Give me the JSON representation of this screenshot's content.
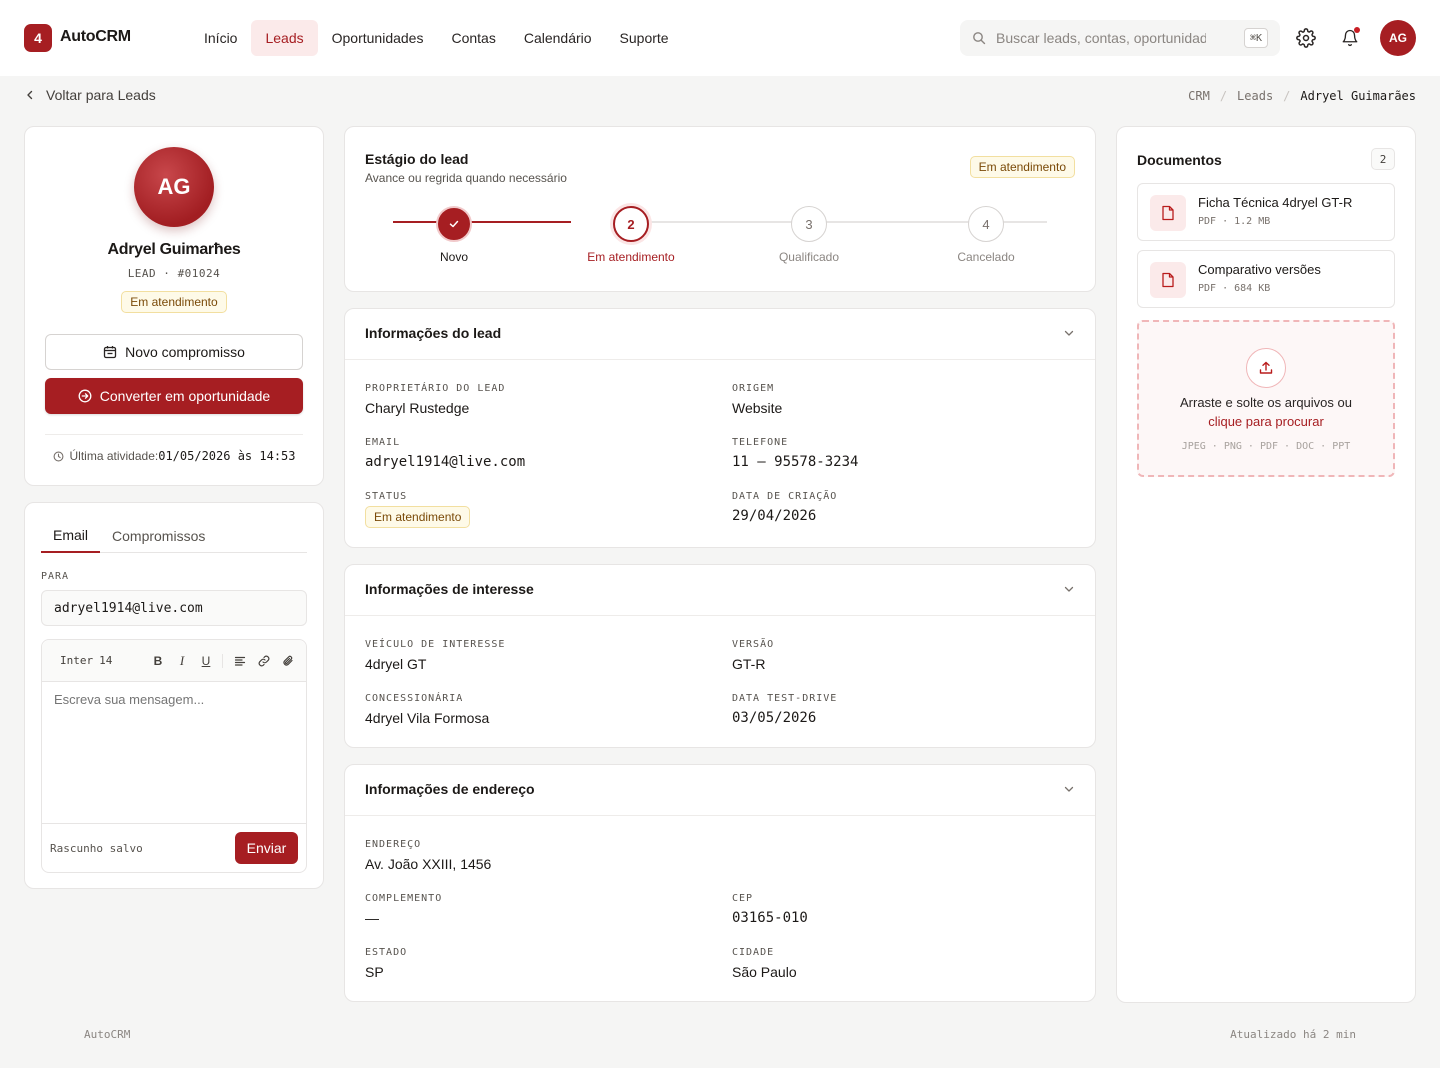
{
  "app": {
    "logo_badge": "4",
    "name": "AutoCRM"
  },
  "nav": [
    {
      "label": "Início",
      "active": false
    },
    {
      "label": "Leads",
      "active": true
    },
    {
      "label": "Oportunidades",
      "active": false
    },
    {
      "label": "Contas",
      "active": false
    },
    {
      "label": "Calendário",
      "active": false
    },
    {
      "label": "Suporte",
      "active": false
    }
  ],
  "search": {
    "placeholder": "Buscar leads, contas, oportunidade",
    "shortcut": "⌘K"
  },
  "user": {
    "initials": "AG"
  },
  "back_label": "Voltar para Leads",
  "breadcrumb": [
    "CRM",
    "Leads",
    "Adryel Guimarães"
  ],
  "profile": {
    "initials": "AG",
    "name": "Adryel Guimarћes",
    "type": "LEAD",
    "id": "#01024",
    "status": "Em atendimento",
    "new_appointment": "Novo compromisso",
    "convert": "Converter em oportunidade",
    "last_activity_label": "Última atividade:",
    "last_activity_value": "01/05/2026 às 14:53"
  },
  "composer": {
    "tabs": [
      {
        "label": "Email",
        "active": true
      },
      {
        "label": "Compromissos",
        "active": false
      }
    ],
    "to_label": "PARA",
    "to_value": "adryel1914@live.com",
    "font": "Inter",
    "font_size": "14",
    "placeholder": "Escreva sua mensagem...",
    "draft_status": "Rascunho salvo",
    "send": "Enviar"
  },
  "stage": {
    "title": "Estágio do lead",
    "subtitle": "Avance ou regrida quando necessário",
    "badge": "Em atendimento",
    "steps": [
      {
        "num": "1",
        "label": "Novo",
        "state": "done"
      },
      {
        "num": "2",
        "label": "Em atendimento",
        "state": "current"
      },
      {
        "num": "3",
        "label": "Qualificado",
        "state": "pending"
      },
      {
        "num": "4",
        "label": "Cancelado",
        "state": "pending"
      }
    ]
  },
  "lead_info": {
    "title": "Informações do lead",
    "owner_label": "PROPRIETÁRIO DO LEAD",
    "owner": "Charyl Rustedge",
    "origin_label": "ORIGEM",
    "origin": "Website",
    "email_label": "EMAIL",
    "email": "adryel1914@live.com",
    "phone_label": "TELEFONE",
    "phone": "11 – 95578-3234",
    "status_label": "STATUS",
    "status": "Em atendimento",
    "created_label": "DATA DE CRIAÇÃO",
    "created": "29/04/2026"
  },
  "interest_info": {
    "title": "Informações de interesse",
    "vehicle_label": "VEÍCULO DE INTERESSE",
    "vehicle": "4dryel GT",
    "version_label": "VERSÃO",
    "version": "GT-R",
    "dealer_label": "CONCESSIONÁRIA",
    "dealer": "4dryel Vila Formosa",
    "testdrive_label": "DATA TEST-DRIVE",
    "testdrive": "03/05/2026"
  },
  "address_info": {
    "title": "Informações de endereço",
    "address_label": "ENDEREÇO",
    "address": "Av. João XXIII, 1456",
    "complement_label": "COMPLEMENTO",
    "complement": "—",
    "cep_label": "CEP",
    "cep": "03165-010",
    "state_label": "ESTADO",
    "state": "SP",
    "city_label": "CIDADE",
    "city": "São Paulo"
  },
  "documents": {
    "title": "Documentos",
    "count": "2",
    "items": [
      {
        "name": "Ficha Técnica 4dryel GT-R",
        "type": "PDF",
        "size": "1.2 MB"
      },
      {
        "name": "Comparativo versões",
        "type": "PDF",
        "size": "684 KB"
      }
    ],
    "drop_text": "Arraste e solte os arquivos ou",
    "drop_link": "clique para procurar",
    "formats": "JPEG · PNG · PDF · DOC · PPT"
  },
  "footer": {
    "left": "AutoCRM",
    "right": "Atualizado há 2 min"
  },
  "colors": {
    "brand": "#a61e22",
    "badge_bg": "#fefae8",
    "badge_text": "#7a4a08"
  }
}
